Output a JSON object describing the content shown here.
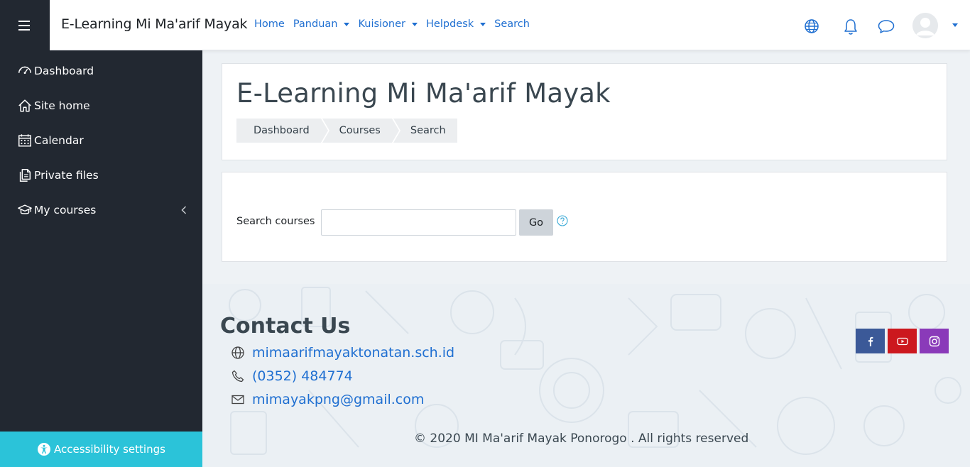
{
  "header": {
    "brand": "E-Learning Mi Ma'arif Mayak",
    "nav": [
      {
        "label": "Home",
        "dropdown": false
      },
      {
        "label": "Panduan",
        "dropdown": true
      },
      {
        "label": "Kuisioner",
        "dropdown": true
      },
      {
        "label": "Helpdesk",
        "dropdown": true
      },
      {
        "label": "Search",
        "dropdown": false
      }
    ],
    "icons": [
      "language-icon",
      "notification-bell-icon",
      "messages-icon",
      "user-avatar"
    ]
  },
  "sidebar": {
    "items": [
      {
        "label": "Dashboard",
        "icon": "dashboard-icon"
      },
      {
        "label": "Site home",
        "icon": "home-icon"
      },
      {
        "label": "Calendar",
        "icon": "calendar-icon"
      },
      {
        "label": "Private files",
        "icon": "files-icon"
      },
      {
        "label": "My courses",
        "icon": "graduation-cap-icon"
      }
    ],
    "accessibility": "Accessibility settings"
  },
  "page": {
    "title": "E-Learning Mi Ma'arif Mayak",
    "breadcrumb": [
      "Dashboard",
      "Courses",
      "Search"
    ]
  },
  "search": {
    "label": "Search courses",
    "value": "",
    "button": "Go"
  },
  "footer": {
    "contact_title": "Contact Us",
    "website": "mimaarifmayaktonatan.sch.id",
    "phone": "(0352) 484774",
    "email": "mimayakpng@gmail.com",
    "copyright": "© 2020 MI Ma'arif Mayak Ponorogo . All rights reserved",
    "social": [
      {
        "name": "facebook",
        "color": "#3b5998"
      },
      {
        "name": "youtube",
        "color": "#cc181e"
      },
      {
        "name": "instagram",
        "color": "#8a3ab9"
      }
    ]
  },
  "colors": {
    "link": "#1f6fd1",
    "sidebar_bg": "#222831",
    "accessibility_bg": "#2bc3d9"
  }
}
